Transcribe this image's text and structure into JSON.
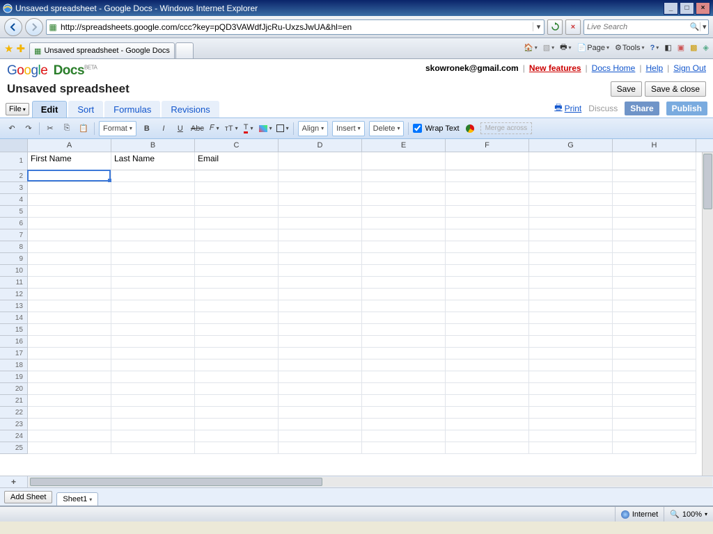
{
  "browser": {
    "title": "Unsaved spreadsheet - Google Docs - Windows Internet Explorer",
    "address": "http://spreadsheets.google.com/ccc?key=pQD3VAWdfJjcRu-UxzsJwUA&hl=en",
    "search_placeholder": "Live Search",
    "tab_title": "Unsaved spreadsheet - Google Docs",
    "tb": {
      "page": "Page",
      "tools": "Tools"
    },
    "status_zone": "Internet",
    "zoom": "100%"
  },
  "gdocs": {
    "logo_docs": "Docs",
    "logo_beta": "BETA",
    "user_email": "skowronek@gmail.com",
    "links": {
      "new_features": "New features",
      "docs_home": "Docs Home",
      "help": "Help",
      "signout": "Sign Out"
    },
    "doc_title": "Unsaved spreadsheet",
    "save": "Save",
    "save_close": "Save & close",
    "file_menu": "File",
    "tabs": {
      "edit": "Edit",
      "sort": "Sort",
      "formulas": "Formulas",
      "revisions": "Revisions"
    },
    "right_tabs": {
      "print": "Print",
      "discuss": "Discuss",
      "share": "Share",
      "publish": "Publish"
    },
    "toolbar": {
      "format": "Format",
      "align": "Align",
      "insert": "Insert",
      "delete": "Delete",
      "wrap": "Wrap Text",
      "merge": "Merge across"
    },
    "add_sheet": "Add Sheet",
    "sheet1": "Sheet1"
  },
  "grid": {
    "columns": [
      "A",
      "B",
      "C",
      "D",
      "E",
      "F",
      "G",
      "H"
    ],
    "row1": {
      "A": "First Name",
      "B": "Last Name",
      "C": "Email"
    },
    "rows_shown": 25,
    "selected_cell": "A2"
  }
}
